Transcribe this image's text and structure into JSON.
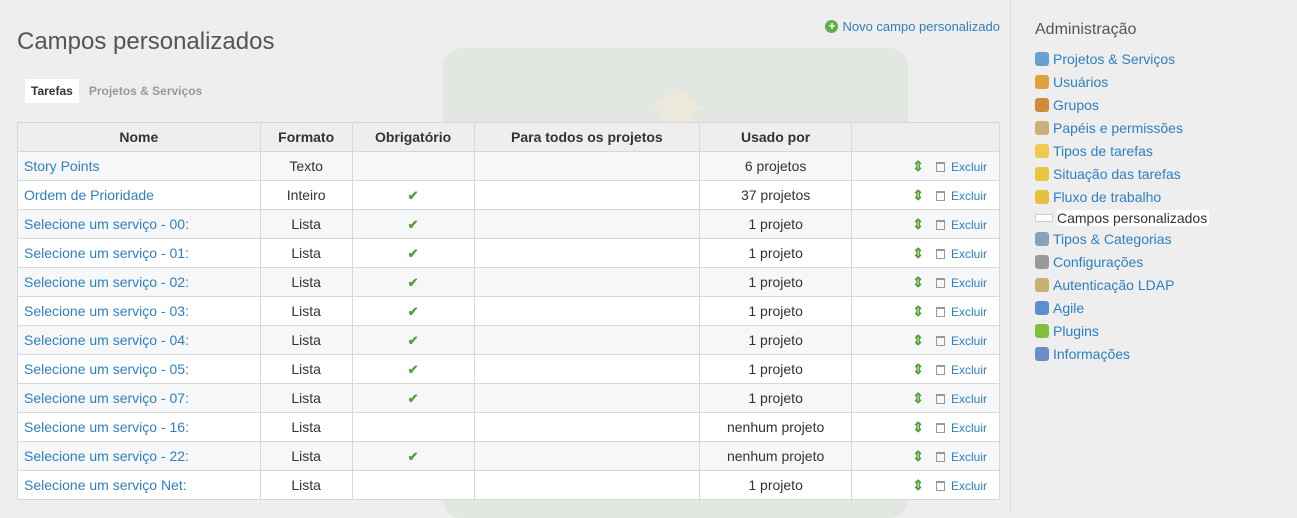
{
  "main": {
    "title": "Campos personalizados",
    "new_link": "Novo campo personalizado",
    "tabs": [
      {
        "label": "Tarefas",
        "active": true
      },
      {
        "label": "Projetos & Serviços",
        "active": false
      }
    ],
    "columns": [
      "Nome",
      "Formato",
      "Obrigatório",
      "Para todos os projetos",
      "Usado por",
      ""
    ],
    "delete_label": "Excluir",
    "check_glyph": "✔",
    "reorder_glyph": "⇕",
    "rows": [
      {
        "name": "Story Points",
        "format": "Texto",
        "required": "",
        "all_projects": "",
        "used_by": "6 projetos"
      },
      {
        "name": "Ordem de Prioridade",
        "format": "Inteiro",
        "required": "✔",
        "all_projects": "",
        "used_by": "37 projetos"
      },
      {
        "name": "Selecione um serviço - 00:",
        "format": "Lista",
        "required": "✔",
        "all_projects": "",
        "used_by": "1 projeto"
      },
      {
        "name": "Selecione um serviço - 01:",
        "format": "Lista",
        "required": "✔",
        "all_projects": "",
        "used_by": "1 projeto"
      },
      {
        "name": "Selecione um serviço - 02:",
        "format": "Lista",
        "required": "✔",
        "all_projects": "",
        "used_by": "1 projeto"
      },
      {
        "name": "Selecione um serviço - 03:",
        "format": "Lista",
        "required": "✔",
        "all_projects": "",
        "used_by": "1 projeto"
      },
      {
        "name": "Selecione um serviço - 04:",
        "format": "Lista",
        "required": "✔",
        "all_projects": "",
        "used_by": "1 projeto"
      },
      {
        "name": "Selecione um serviço - 05:",
        "format": "Lista",
        "required": "✔",
        "all_projects": "",
        "used_by": "1 projeto"
      },
      {
        "name": "Selecione um serviço - 07:",
        "format": "Lista",
        "required": "✔",
        "all_projects": "",
        "used_by": "1 projeto"
      },
      {
        "name": "Selecione um serviço - 16:",
        "format": "Lista",
        "required": "",
        "all_projects": "",
        "used_by": "nenhum projeto"
      },
      {
        "name": "Selecione um serviço - 22:",
        "format": "Lista",
        "required": "✔",
        "all_projects": "",
        "used_by": "nenhum projeto"
      },
      {
        "name": "Selecione um serviço Net:",
        "format": "Lista",
        "required": "",
        "all_projects": "",
        "used_by": "1 projeto"
      }
    ]
  },
  "sidebar": {
    "title": "Administração",
    "items": [
      {
        "label": "Projetos & Serviços",
        "icon": "projects-icon",
        "color": "#6a9fd4",
        "selected": false
      },
      {
        "label": "Usuários",
        "icon": "user-icon",
        "color": "#e0a040",
        "selected": false
      },
      {
        "label": "Grupos",
        "icon": "group-icon",
        "color": "#d08a3a",
        "selected": false
      },
      {
        "label": "Papéis e permissões",
        "icon": "roles-icon",
        "color": "#c9b27a",
        "selected": false
      },
      {
        "label": "Tipos de tarefas",
        "icon": "tracker-icon",
        "color": "#f2c94c",
        "selected": false
      },
      {
        "label": "Situação das tarefas",
        "icon": "status-icon",
        "color": "#e6c640",
        "selected": false
      },
      {
        "label": "Fluxo de trabalho",
        "icon": "workflow-icon",
        "color": "#e8c040",
        "selected": false
      },
      {
        "label": "Campos personalizados",
        "icon": "custom-field-icon",
        "color": "#ffffff",
        "selected": true
      },
      {
        "label": "Tipos & Categorias",
        "icon": "list-icon",
        "color": "#8aa0b8",
        "selected": false
      },
      {
        "label": "Configurações",
        "icon": "settings-icon",
        "color": "#9a9a9a",
        "selected": false
      },
      {
        "label": "Autenticação LDAP",
        "icon": "ldap-icon",
        "color": "#c8b070",
        "selected": false
      },
      {
        "label": "Agile",
        "icon": "agile-icon",
        "color": "#5a8fd0",
        "selected": false
      },
      {
        "label": "Plugins",
        "icon": "plugin-icon",
        "color": "#7fbf3f",
        "selected": false
      },
      {
        "label": "Informações",
        "icon": "info-icon",
        "color": "#6a8fc8",
        "selected": false
      }
    ]
  }
}
